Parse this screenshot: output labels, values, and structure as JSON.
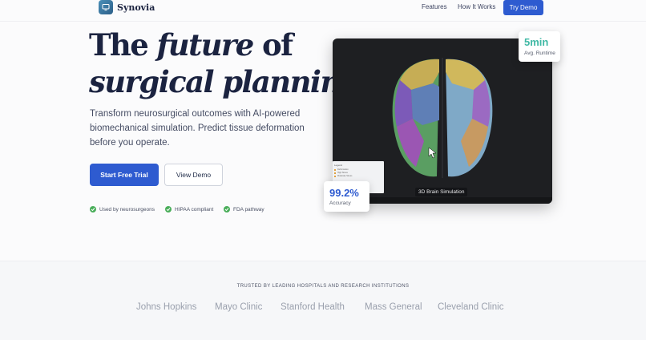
{
  "nav": {
    "logo_text": "Synovia",
    "logo_icon": "monitor-icon",
    "links": [
      "Features",
      "How It Works"
    ],
    "cta": "Try Demo"
  },
  "hero": {
    "headline_line1_a": "The ",
    "headline_line1_b": "future",
    "headline_line1_c": " of",
    "headline_line2": "surgical planning",
    "subtitle": "Transform neurosurgical outcomes with AI-powered biomechanical simulation. Predict tissue deformation before you operate.",
    "primary_button": "Start Free Trial",
    "secondary_button": "View Demo",
    "badges": [
      "Used by neurosurgeons",
      "HIPAA compliant",
      "FDA pathway"
    ]
  },
  "viewer": {
    "label": "3D Brain Simulation",
    "legend_title": "Legend",
    "legend_items": [
      "Deformation",
      "High Stress",
      "Moderate Stress"
    ],
    "runtime_value": "5min",
    "runtime_label": "Avg. Runtime",
    "accuracy_value": "99.2%",
    "accuracy_label": "Accuracy"
  },
  "trusted": {
    "label": "TRUSTED BY LEADING HOSPITALS AND RESEARCH INSTITUTIONS",
    "hospitals": [
      "Johns Hopkins",
      "Mayo Clinic",
      "Stanford Health",
      "Mass General",
      "Cleveland Clinic"
    ]
  },
  "colors": {
    "accent": "#2e5bd0",
    "teal": "#3fb8a4",
    "check": "#4aae5a",
    "headline": "#1b2340"
  }
}
